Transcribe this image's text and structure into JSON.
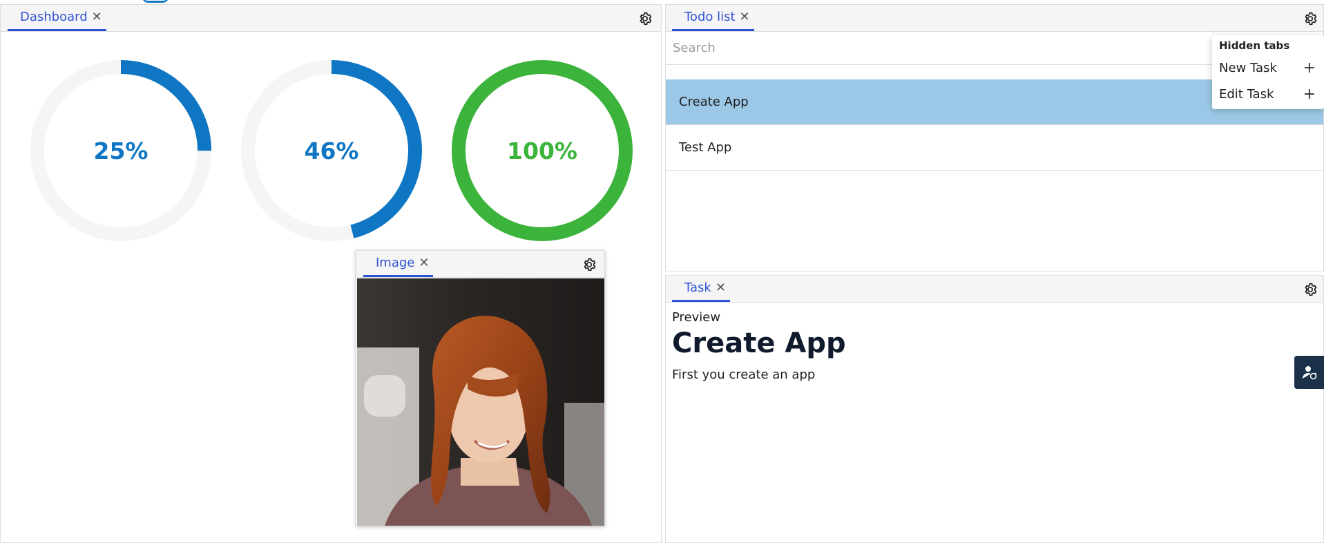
{
  "dashboard": {
    "tab_label": "Dashboard",
    "gauges": [
      {
        "label": "25%",
        "value": 0.25,
        "color": "#0f76c4"
      },
      {
        "label": "46%",
        "value": 0.46,
        "color": "#0f76c4"
      },
      {
        "label": "100%",
        "value": 1.0,
        "color": "#3cb43c"
      }
    ],
    "track_color": "#f5f5f5"
  },
  "image_panel": {
    "tab_label": "Image"
  },
  "todo": {
    "tab_label": "Todo list",
    "search_placeholder": "Search",
    "items": [
      {
        "label": "Create App",
        "selected": true
      },
      {
        "label": "Test App",
        "selected": false
      }
    ]
  },
  "hidden_tabs": {
    "title": "Hidden tabs",
    "items": [
      {
        "label": "New Task"
      },
      {
        "label": "Edit Task"
      }
    ]
  },
  "task": {
    "tab_label": "Task",
    "preview_label": "Preview",
    "title": "Create App",
    "description": "First you create an app"
  },
  "colors": {
    "accent": "#2f53d6",
    "selected_row": "#9bc8e6",
    "fab": "#1b3049"
  },
  "icons": {
    "gear": "gear-icon",
    "close": "close-icon",
    "plus": "plus-icon",
    "user": "user-refresh-icon"
  }
}
